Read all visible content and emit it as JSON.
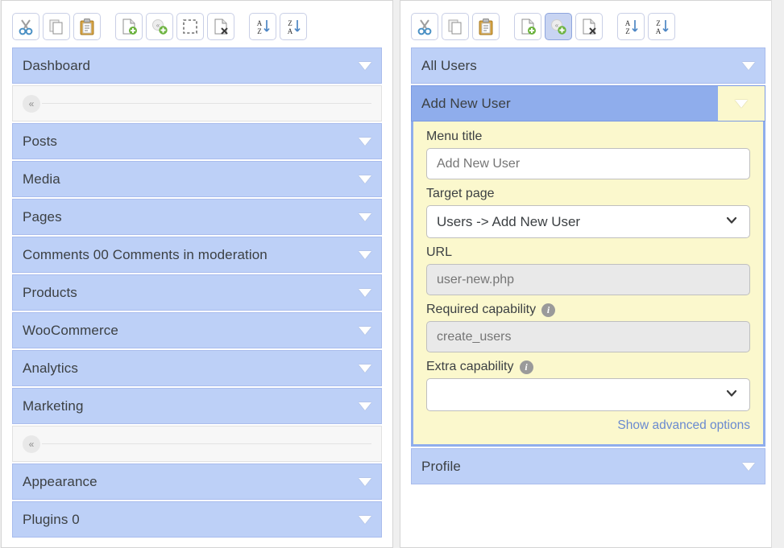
{
  "theme": {
    "row_bg": "#bdd0f7",
    "row_selected_bg": "#8fadec",
    "editor_bg": "#fbf8cd",
    "link_color": "#6a8ad0",
    "page_bg": "#efefef"
  },
  "toolbar": {
    "buttons": [
      {
        "name": "cut-icon",
        "title": "Cut",
        "selected": false,
        "gap": false
      },
      {
        "name": "copy-icon",
        "title": "Copy",
        "selected": false,
        "gap": false
      },
      {
        "name": "paste-icon",
        "title": "Paste",
        "selected": false,
        "gap": false
      },
      {
        "name": "new-page-icon",
        "title": "New menu item",
        "selected": false,
        "gap": true
      },
      {
        "name": "new-separator-icon",
        "title": "New separator",
        "selected": false,
        "gap": false
      },
      {
        "name": "select-all-icon",
        "title": "Select all",
        "selected": false,
        "gap": false
      },
      {
        "name": "delete-page-icon",
        "title": "Delete menu",
        "selected": false,
        "gap": false
      },
      {
        "name": "sort-az-icon",
        "title": "Sort A-Z",
        "selected": false,
        "gap": true
      },
      {
        "name": "sort-za-icon",
        "title": "Sort Z-A",
        "selected": false,
        "gap": false
      }
    ],
    "buttons_right": [
      {
        "name": "cut-icon",
        "title": "Cut",
        "selected": false,
        "gap": false
      },
      {
        "name": "copy-icon",
        "title": "Copy",
        "selected": false,
        "gap": false
      },
      {
        "name": "paste-icon",
        "title": "Paste",
        "selected": false,
        "gap": false
      },
      {
        "name": "new-page-icon",
        "title": "New menu item",
        "selected": false,
        "gap": true
      },
      {
        "name": "new-separator-icon",
        "title": "New separator",
        "selected": true,
        "gap": false
      },
      {
        "name": "delete-page-icon",
        "title": "Delete menu",
        "selected": false,
        "gap": false
      },
      {
        "name": "sort-az-icon",
        "title": "Sort A-Z",
        "selected": false,
        "gap": true
      },
      {
        "name": "sort-za-icon",
        "title": "Sort Z-A",
        "selected": false,
        "gap": false
      }
    ]
  },
  "left_panel": {
    "rows": [
      {
        "type": "item",
        "label": "Dashboard"
      },
      {
        "type": "separator",
        "handle": "«"
      },
      {
        "type": "item",
        "label": "Posts"
      },
      {
        "type": "item",
        "label": "Media"
      },
      {
        "type": "item",
        "label": "Pages"
      },
      {
        "type": "item",
        "label": "Comments 00 Comments in moderation"
      },
      {
        "type": "item",
        "label": "Products"
      },
      {
        "type": "item",
        "label": "WooCommerce"
      },
      {
        "type": "item",
        "label": "Analytics"
      },
      {
        "type": "item",
        "label": "Marketing"
      },
      {
        "type": "separator",
        "handle": "«"
      },
      {
        "type": "item",
        "label": "Appearance"
      },
      {
        "type": "item",
        "label": "Plugins 0"
      }
    ]
  },
  "right_panel": {
    "rows_before": [
      {
        "type": "item",
        "label": "All Users"
      }
    ],
    "selected_row": {
      "label": "Add New User"
    },
    "rows_after": [
      {
        "type": "item",
        "label": "Profile"
      }
    ],
    "editor": {
      "fields": [
        {
          "name": "menu-title",
          "label": "Menu title",
          "control": "text",
          "value": "Add New User",
          "placeholder": "Add New User",
          "readonly": false,
          "info": false
        },
        {
          "name": "target-page",
          "label": "Target page",
          "control": "select",
          "value": "Users -> Add New User",
          "readonly": false,
          "info": false
        },
        {
          "name": "url",
          "label": "URL",
          "control": "text",
          "value": "user-new.php",
          "placeholder": "user-new.php",
          "readonly": true,
          "info": false
        },
        {
          "name": "required-capability",
          "label": "Required capability",
          "control": "text",
          "value": "create_users",
          "placeholder": "create_users",
          "readonly": true,
          "info": true
        },
        {
          "name": "extra-capability",
          "label": "Extra capability",
          "control": "select",
          "value": "",
          "readonly": false,
          "info": true
        }
      ],
      "advanced_link": "Show advanced options"
    }
  }
}
